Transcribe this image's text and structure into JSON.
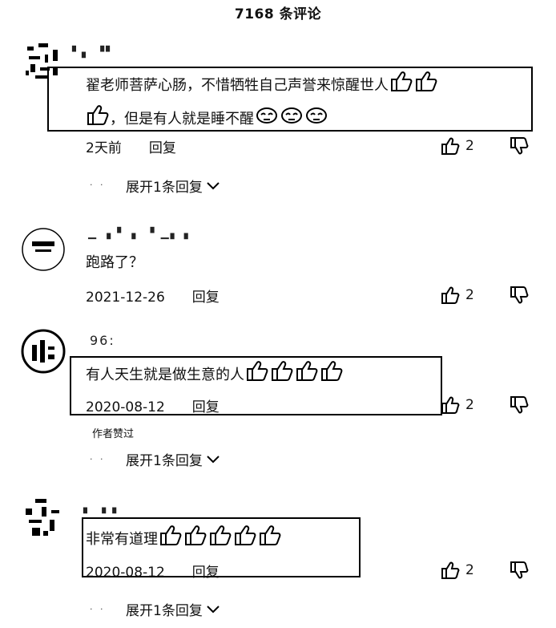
{
  "header": {
    "title": "7168 条评论"
  },
  "comments": [
    {
      "username": "▘▖ ▝▘",
      "text_line1": "翟老师菩萨心肠，不惜牺牲自己声誉来惊醒世人",
      "text_line2": "，但是有人就是睡不醒",
      "time": "2天前",
      "reply_label": "回复",
      "likes": "2",
      "expand_label": "展开1条回复"
    },
    {
      "username": "▁ ▗ ▘ ▖ ▝ ▁▖▗",
      "text": "跑路了？",
      "time": "2021-12-26",
      "reply_label": "回复",
      "likes": "2"
    },
    {
      "username": "96:",
      "text": "有人天生就是做生意的人",
      "time": "2020-08-12",
      "reply_label": "回复",
      "likes": "2",
      "author_tag": "作者赞过",
      "expand_label": "展开1条回复"
    },
    {
      "username": "▖ ▗ ▖",
      "text": "非常有道理",
      "time": "2020-08-12",
      "reply_label": "回复",
      "likes": "2",
      "expand_label": "展开1条回复"
    }
  ]
}
